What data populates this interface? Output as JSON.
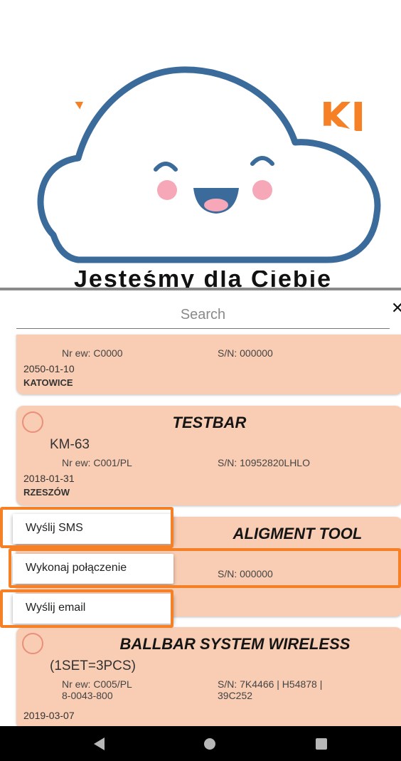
{
  "header": {
    "brand_left": "Y",
    "brand_right": "KI",
    "sub_text": "Jesteśmy dla Ciebie"
  },
  "search": {
    "placeholder": "Search",
    "close_icon": "✕"
  },
  "cards": [
    {
      "title": "",
      "model": "",
      "nr_ew": "Nr ew: C0000",
      "sn": "S/N:  000000",
      "date": "2050-01-10",
      "city": "KATOWICE"
    },
    {
      "title": "TESTBAR",
      "model": "KM-63",
      "nr_ew": "Nr ew: C001/PL",
      "sn": "S/N:  10952820LHLO",
      "date": "2018-01-31",
      "city": "RZESZÓW"
    },
    {
      "title": "ALIGMENT TOOL",
      "model": "",
      "nr_ew": "",
      "sn": "S/N:  000000",
      "date": "",
      "city": ""
    },
    {
      "title": "BALLBAR SYSTEM WIRELESS",
      "model": "(1SET=3PCS)",
      "nr_ew": "Nr ew: C005/PL\n8-0043-800",
      "sn": "S/N:  7K4466 | H54878 |\n39C252",
      "date": "2019-03-07",
      "city": ""
    }
  ],
  "context_menu": {
    "sms": "Wyślij SMS",
    "call": "Wykonaj połączenie",
    "email": "Wyślij email"
  },
  "colors": {
    "card_bg": "#f9cdb3",
    "accent": "#f58025",
    "radio": "#e98f7b",
    "cloud_outline": "#3b6b9a"
  },
  "icons": {
    "cloud": "smiling-cloud-icon",
    "nav_back": "back-triangle-icon",
    "nav_home": "home-circle-icon",
    "nav_recent": "recent-square-icon"
  }
}
